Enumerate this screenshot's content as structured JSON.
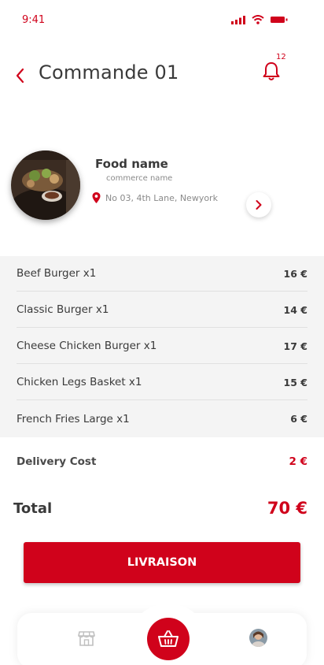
{
  "status_bar": {
    "time": "9:41"
  },
  "header": {
    "title": "Commande 01",
    "notifications_count": "12"
  },
  "store": {
    "name": "Food name",
    "commerce": "commerce name",
    "address": "No 03, 4th Lane, Newyork"
  },
  "order_items": [
    {
      "name": "Beef Burger x1",
      "price": "16 €"
    },
    {
      "name": "Classic Burger x1",
      "price": "14 €"
    },
    {
      "name": "Cheese Chicken Burger x1",
      "price": "17 €"
    },
    {
      "name": "Chicken Legs Basket x1",
      "price": "15 €"
    },
    {
      "name": "French Fries Large x1",
      "price": "6 €"
    }
  ],
  "delivery": {
    "label": "Delivery Cost",
    "value": "2 €"
  },
  "total": {
    "label": "Total",
    "value": "70 €"
  },
  "cta": {
    "label": "LIVRAISON"
  },
  "bottom_nav": {
    "items": [
      {
        "icon": "store-icon"
      },
      {
        "icon": "basket-icon",
        "active": true
      },
      {
        "icon": "avatar"
      }
    ]
  },
  "colors": {
    "accent": "#d0021b",
    "text": "#3a3a3a",
    "muted": "#8a8a8a",
    "panel": "#f4f4f4"
  }
}
